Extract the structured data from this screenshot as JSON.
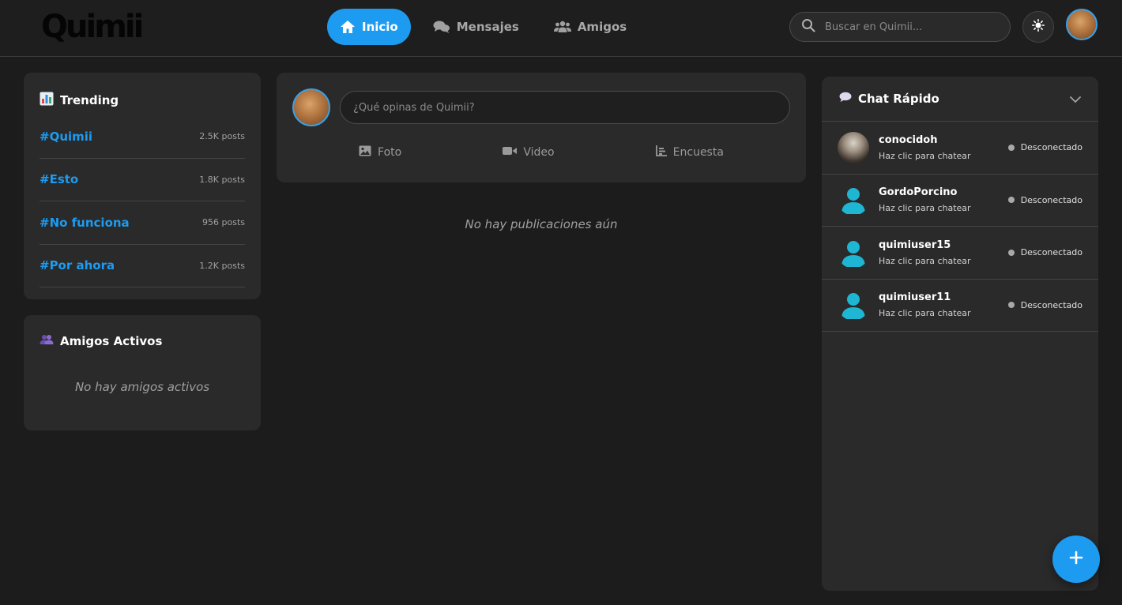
{
  "header": {
    "logo": "Quimii",
    "nav": [
      {
        "label": "Inicio",
        "icon": "home-icon",
        "active": true
      },
      {
        "label": "Mensajes",
        "icon": "chat-bubbles-icon",
        "active": false
      },
      {
        "label": "Amigos",
        "icon": "users-icon",
        "active": false
      }
    ],
    "search_placeholder": "Buscar en Quimii...",
    "theme_icon": "sun-icon"
  },
  "trending": {
    "title": "Trending",
    "icon": "bar-chart-icon",
    "items": [
      {
        "tag": "#Quimii",
        "count": "2.5K posts"
      },
      {
        "tag": "#Esto",
        "count": "1.8K posts"
      },
      {
        "tag": "#No funciona",
        "count": "956 posts"
      },
      {
        "tag": "#Por ahora",
        "count": "1.2K posts"
      }
    ]
  },
  "friends": {
    "title": "Amigos Activos",
    "icon": "people-icon",
    "empty": "No hay amigos activos"
  },
  "composer": {
    "placeholder": "¿Qué opinas de Quimii?",
    "actions": [
      {
        "label": "Foto",
        "icon": "image-icon"
      },
      {
        "label": "Video",
        "icon": "video-icon"
      },
      {
        "label": "Encuesta",
        "icon": "poll-icon"
      }
    ]
  },
  "feed": {
    "empty": "No hay publicaciones aún"
  },
  "chat": {
    "title": "Chat Rápido",
    "icon": "speech-bubble-icon",
    "users": [
      {
        "name": "conocidoh",
        "sub": "Haz clic para chatear",
        "status": "Desconectado",
        "avatar": "photo"
      },
      {
        "name": "GordoPorcino",
        "sub": "Haz clic para chatear",
        "status": "Desconectado",
        "avatar": "default"
      },
      {
        "name": "quimiuser15",
        "sub": "Haz clic para chatear",
        "status": "Desconectado",
        "avatar": "default"
      },
      {
        "name": "quimiuser11",
        "sub": "Haz clic para chatear",
        "status": "Desconectado",
        "avatar": "default"
      }
    ]
  },
  "colors": {
    "accent": "#1d9bf0",
    "avatar_default": "#1eb6d2",
    "background": "#1c1c1c",
    "card": "#2a2a2a"
  }
}
